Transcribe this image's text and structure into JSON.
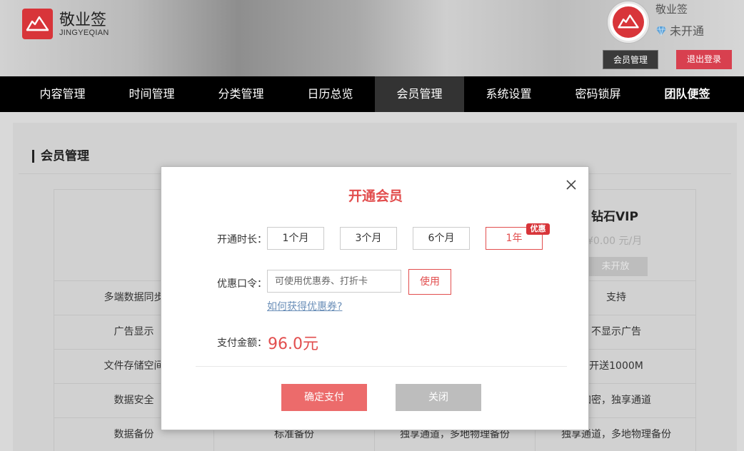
{
  "header": {
    "brand_name": "敬业签",
    "brand_sub": "JINGYEQIAN",
    "username": "敬业签",
    "vip_status": "未开通",
    "member_btn": "会员管理",
    "logout_btn": "退出登录"
  },
  "nav": {
    "items": [
      {
        "label": "内容管理"
      },
      {
        "label": "时间管理"
      },
      {
        "label": "分类管理"
      },
      {
        "label": "日历总览"
      },
      {
        "label": "会员管理"
      },
      {
        "label": "系统设置"
      },
      {
        "label": "密码锁屏"
      },
      {
        "label": "团队便签"
      }
    ],
    "active_index": 4
  },
  "page": {
    "title": "会员管理",
    "plan": {
      "name": "钻石VIP",
      "price": "¥0.00 元/月",
      "button": "未开放"
    },
    "rows": [
      [
        "多端数据同步",
        "",
        "",
        "支持"
      ],
      [
        "广告显示",
        "",
        "",
        "不显示广告"
      ],
      [
        "文件存储空间",
        "",
        "",
        "开送1000M"
      ],
      [
        "数据安全",
        "",
        "",
        "加密，独享通道"
      ],
      [
        "数据备份",
        "标准备份",
        "独享通道，多地物理备份",
        "独享通道，多地物理备份"
      ]
    ]
  },
  "modal": {
    "title": "开通会员",
    "duration_label": "开通时长：",
    "durations": [
      "1个月",
      "3个月",
      "6个月",
      "1年"
    ],
    "selected_duration": "1年",
    "badge": "优惠",
    "coupon_label": "优惠口令：",
    "coupon_placeholder": "可使用优惠券、打折卡",
    "use_btn": "使用",
    "coupon_link": "如何获得优惠券?",
    "amount_label": "支付金额：",
    "amount": "96.0元",
    "confirm_btn": "确定支付",
    "close_btn": "关闭"
  },
  "colors": {
    "brand_red": "#d8353a",
    "accent_red": "#e24e4e",
    "nav_bg": "#000000"
  }
}
